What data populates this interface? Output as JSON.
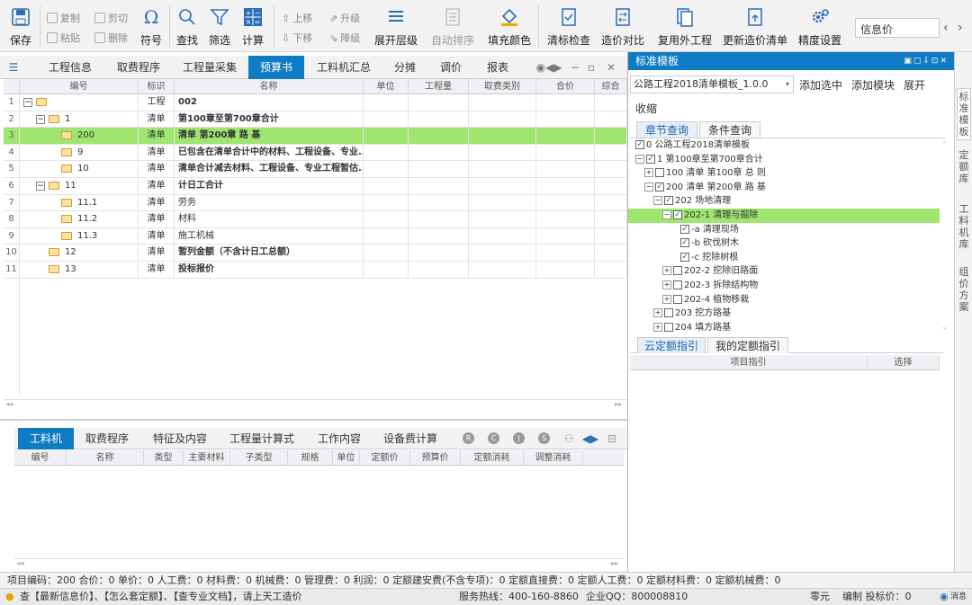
{
  "toolbar": {
    "save": "保存",
    "copy": "复制",
    "cut": "剪切",
    "paste": "粘贴",
    "delete": "删除",
    "symbol": "符号",
    "find": "查找",
    "filter": "筛选",
    "calc": "计算",
    "move_up": "上移",
    "move_down": "下移",
    "upgrade": "升级",
    "downgrade": "降级",
    "expand_level": "展开层级",
    "auto_sort": "自动排序",
    "fill_color": "填充颜色",
    "check_bill": "清标检查",
    "price_compare": "造价对比",
    "reuse_project": "复用外工程",
    "update_bill": "更新造价清单",
    "precision": "精度设置",
    "info_price": "信息价"
  },
  "main_tabs": [
    "工程信息",
    "取费程序",
    "工程量采集",
    "预算书",
    "工料机汇总",
    "分摊",
    "调价",
    "报表"
  ],
  "active_main_tab": "预算书",
  "grid_headers": {
    "code": "编号",
    "flag": "标识",
    "name": "名称",
    "unit": "单位",
    "qty": "工程量",
    "category": "取费类别",
    "total": "合价",
    "more": "综合"
  },
  "rows": [
    {
      "rn": "1",
      "code": "",
      "flag": "工程",
      "name": "002"
    },
    {
      "rn": "2",
      "code": "1",
      "flag": "清单",
      "name": "第100章至第700章合计"
    },
    {
      "rn": "3",
      "code": "200",
      "flag": "清单",
      "name": "清单 第200章 路 基"
    },
    {
      "rn": "4",
      "code": "9",
      "flag": "清单",
      "name": "已包含在清单合计中的材料、工程设备、专业..."
    },
    {
      "rn": "5",
      "code": "10",
      "flag": "清单",
      "name": "清单合计减去材料、工程设备、专业工程暂估..."
    },
    {
      "rn": "6",
      "code": "11",
      "flag": "清单",
      "name": "计日工合计"
    },
    {
      "rn": "7",
      "code": "11.1",
      "flag": "清单",
      "name": "劳务"
    },
    {
      "rn": "8",
      "code": "11.2",
      "flag": "清单",
      "name": "材料"
    },
    {
      "rn": "9",
      "code": "11.3",
      "flag": "清单",
      "name": "施工机械"
    },
    {
      "rn": "10",
      "code": "12",
      "flag": "清单",
      "name": "暂列金额（不含计日工总额）"
    },
    {
      "rn": "11",
      "code": "13",
      "flag": "清单",
      "name": "投标报价"
    }
  ],
  "bottom_tabs": [
    "工料机",
    "取费程序",
    "特征及内容",
    "工程量计算式",
    "工作内容",
    "设备费计算"
  ],
  "bottom_headers": [
    "编号",
    "名称",
    "类型",
    "主要材料",
    "子类型",
    "规格",
    "单位",
    "定额价",
    "预算价",
    "定额消耗",
    "调整消耗"
  ],
  "right_panel": {
    "title": "标准模板",
    "template": "公路工程2018清单模板_1.0.0",
    "add_selected": "添加选中",
    "add_module": "添加模块",
    "expand": "展开",
    "collapse": "收缩",
    "tab_chapter": "章节查询",
    "tab_condition": "条件查询",
    "tree": [
      {
        "label": "0 公路工程2018清单模板",
        "indent": 0,
        "pm": "",
        "ck": true
      },
      {
        "label": "1 第100章至第700章合计",
        "indent": 0,
        "pm": "−",
        "ck": true
      },
      {
        "label": "100 清单 第100章 总 则",
        "indent": 1,
        "pm": "+",
        "ck": false
      },
      {
        "label": "200 清单 第200章 路 基",
        "indent": 1,
        "pm": "−",
        "ck": true
      },
      {
        "label": "202 场地清理",
        "indent": 2,
        "pm": "−",
        "ck": true
      },
      {
        "label": "202-1 清理与掘除",
        "indent": 3,
        "pm": "−",
        "ck": true
      },
      {
        "label": "-a 清理现场",
        "indent": 5,
        "pm": "",
        "ck": true
      },
      {
        "label": "-b 砍伐树木",
        "indent": 5,
        "pm": "",
        "ck": true
      },
      {
        "label": "-c 挖除树根",
        "indent": 5,
        "pm": "",
        "ck": true
      },
      {
        "label": "202-2 挖除旧路面",
        "indent": 3,
        "pm": "+",
        "ck": false
      },
      {
        "label": "202-3 拆除结构物",
        "indent": 3,
        "pm": "+",
        "ck": false
      },
      {
        "label": "202-4 植物移栽",
        "indent": 3,
        "pm": "+",
        "ck": false
      },
      {
        "label": "203 挖方路基",
        "indent": 2,
        "pm": "+",
        "ck": false
      },
      {
        "label": "204 填方路基",
        "indent": 2,
        "pm": "+",
        "ck": false
      }
    ],
    "guide_tabs": [
      "云定额指引",
      "我的定额指引"
    ],
    "guide_headers": [
      "项目指引",
      "选择"
    ]
  },
  "vertical_tabs": [
    "标准模板",
    "定额库",
    "工料机库",
    "组价方案"
  ],
  "status_line1": "项目编码：200  合价：0  单价：0  人工费：0  材料费：0  机械费：0  管理费：0  利润：0  定额建安费(不含专项)：0  定额直接费：0  定额人工费：0  定额材料费：0  定额机械费：0",
  "status_line2": {
    "tips": "查【最新信息价】、【怎么套定额】、【查专业文档】，请上天工造价",
    "hotline": "服务热线：400-160-8860",
    "qq": "企业QQ：800008810",
    "unit": "零元",
    "mode": "编制 投标价：0",
    "msg": "消息"
  },
  "colors": {
    "accent": "#0f7bc4",
    "selected_row": "#9ee66f"
  }
}
